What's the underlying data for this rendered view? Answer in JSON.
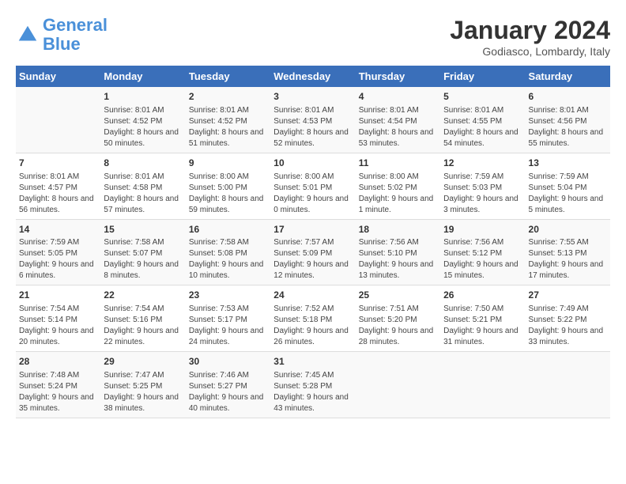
{
  "header": {
    "logo_line1": "General",
    "logo_line2": "Blue",
    "title": "January 2024",
    "subtitle": "Godiasco, Lombardy, Italy"
  },
  "weekdays": [
    "Sunday",
    "Monday",
    "Tuesday",
    "Wednesday",
    "Thursday",
    "Friday",
    "Saturday"
  ],
  "weeks": [
    [
      {
        "day": "",
        "sunrise": "",
        "sunset": "",
        "daylight": ""
      },
      {
        "day": "1",
        "sunrise": "Sunrise: 8:01 AM",
        "sunset": "Sunset: 4:52 PM",
        "daylight": "Daylight: 8 hours and 50 minutes."
      },
      {
        "day": "2",
        "sunrise": "Sunrise: 8:01 AM",
        "sunset": "Sunset: 4:52 PM",
        "daylight": "Daylight: 8 hours and 51 minutes."
      },
      {
        "day": "3",
        "sunrise": "Sunrise: 8:01 AM",
        "sunset": "Sunset: 4:53 PM",
        "daylight": "Daylight: 8 hours and 52 minutes."
      },
      {
        "day": "4",
        "sunrise": "Sunrise: 8:01 AM",
        "sunset": "Sunset: 4:54 PM",
        "daylight": "Daylight: 8 hours and 53 minutes."
      },
      {
        "day": "5",
        "sunrise": "Sunrise: 8:01 AM",
        "sunset": "Sunset: 4:55 PM",
        "daylight": "Daylight: 8 hours and 54 minutes."
      },
      {
        "day": "6",
        "sunrise": "Sunrise: 8:01 AM",
        "sunset": "Sunset: 4:56 PM",
        "daylight": "Daylight: 8 hours and 55 minutes."
      }
    ],
    [
      {
        "day": "7",
        "sunrise": "Sunrise: 8:01 AM",
        "sunset": "Sunset: 4:57 PM",
        "daylight": "Daylight: 8 hours and 56 minutes."
      },
      {
        "day": "8",
        "sunrise": "Sunrise: 8:01 AM",
        "sunset": "Sunset: 4:58 PM",
        "daylight": "Daylight: 8 hours and 57 minutes."
      },
      {
        "day": "9",
        "sunrise": "Sunrise: 8:00 AM",
        "sunset": "Sunset: 5:00 PM",
        "daylight": "Daylight: 8 hours and 59 minutes."
      },
      {
        "day": "10",
        "sunrise": "Sunrise: 8:00 AM",
        "sunset": "Sunset: 5:01 PM",
        "daylight": "Daylight: 9 hours and 0 minutes."
      },
      {
        "day": "11",
        "sunrise": "Sunrise: 8:00 AM",
        "sunset": "Sunset: 5:02 PM",
        "daylight": "Daylight: 9 hours and 1 minute."
      },
      {
        "day": "12",
        "sunrise": "Sunrise: 7:59 AM",
        "sunset": "Sunset: 5:03 PM",
        "daylight": "Daylight: 9 hours and 3 minutes."
      },
      {
        "day": "13",
        "sunrise": "Sunrise: 7:59 AM",
        "sunset": "Sunset: 5:04 PM",
        "daylight": "Daylight: 9 hours and 5 minutes."
      }
    ],
    [
      {
        "day": "14",
        "sunrise": "Sunrise: 7:59 AM",
        "sunset": "Sunset: 5:05 PM",
        "daylight": "Daylight: 9 hours and 6 minutes."
      },
      {
        "day": "15",
        "sunrise": "Sunrise: 7:58 AM",
        "sunset": "Sunset: 5:07 PM",
        "daylight": "Daylight: 9 hours and 8 minutes."
      },
      {
        "day": "16",
        "sunrise": "Sunrise: 7:58 AM",
        "sunset": "Sunset: 5:08 PM",
        "daylight": "Daylight: 9 hours and 10 minutes."
      },
      {
        "day": "17",
        "sunrise": "Sunrise: 7:57 AM",
        "sunset": "Sunset: 5:09 PM",
        "daylight": "Daylight: 9 hours and 12 minutes."
      },
      {
        "day": "18",
        "sunrise": "Sunrise: 7:56 AM",
        "sunset": "Sunset: 5:10 PM",
        "daylight": "Daylight: 9 hours and 13 minutes."
      },
      {
        "day": "19",
        "sunrise": "Sunrise: 7:56 AM",
        "sunset": "Sunset: 5:12 PM",
        "daylight": "Daylight: 9 hours and 15 minutes."
      },
      {
        "day": "20",
        "sunrise": "Sunrise: 7:55 AM",
        "sunset": "Sunset: 5:13 PM",
        "daylight": "Daylight: 9 hours and 17 minutes."
      }
    ],
    [
      {
        "day": "21",
        "sunrise": "Sunrise: 7:54 AM",
        "sunset": "Sunset: 5:14 PM",
        "daylight": "Daylight: 9 hours and 20 minutes."
      },
      {
        "day": "22",
        "sunrise": "Sunrise: 7:54 AM",
        "sunset": "Sunset: 5:16 PM",
        "daylight": "Daylight: 9 hours and 22 minutes."
      },
      {
        "day": "23",
        "sunrise": "Sunrise: 7:53 AM",
        "sunset": "Sunset: 5:17 PM",
        "daylight": "Daylight: 9 hours and 24 minutes."
      },
      {
        "day": "24",
        "sunrise": "Sunrise: 7:52 AM",
        "sunset": "Sunset: 5:18 PM",
        "daylight": "Daylight: 9 hours and 26 minutes."
      },
      {
        "day": "25",
        "sunrise": "Sunrise: 7:51 AM",
        "sunset": "Sunset: 5:20 PM",
        "daylight": "Daylight: 9 hours and 28 minutes."
      },
      {
        "day": "26",
        "sunrise": "Sunrise: 7:50 AM",
        "sunset": "Sunset: 5:21 PM",
        "daylight": "Daylight: 9 hours and 31 minutes."
      },
      {
        "day": "27",
        "sunrise": "Sunrise: 7:49 AM",
        "sunset": "Sunset: 5:22 PM",
        "daylight": "Daylight: 9 hours and 33 minutes."
      }
    ],
    [
      {
        "day": "28",
        "sunrise": "Sunrise: 7:48 AM",
        "sunset": "Sunset: 5:24 PM",
        "daylight": "Daylight: 9 hours and 35 minutes."
      },
      {
        "day": "29",
        "sunrise": "Sunrise: 7:47 AM",
        "sunset": "Sunset: 5:25 PM",
        "daylight": "Daylight: 9 hours and 38 minutes."
      },
      {
        "day": "30",
        "sunrise": "Sunrise: 7:46 AM",
        "sunset": "Sunset: 5:27 PM",
        "daylight": "Daylight: 9 hours and 40 minutes."
      },
      {
        "day": "31",
        "sunrise": "Sunrise: 7:45 AM",
        "sunset": "Sunset: 5:28 PM",
        "daylight": "Daylight: 9 hours and 43 minutes."
      },
      {
        "day": "",
        "sunrise": "",
        "sunset": "",
        "daylight": ""
      },
      {
        "day": "",
        "sunrise": "",
        "sunset": "",
        "daylight": ""
      },
      {
        "day": "",
        "sunrise": "",
        "sunset": "",
        "daylight": ""
      }
    ]
  ]
}
